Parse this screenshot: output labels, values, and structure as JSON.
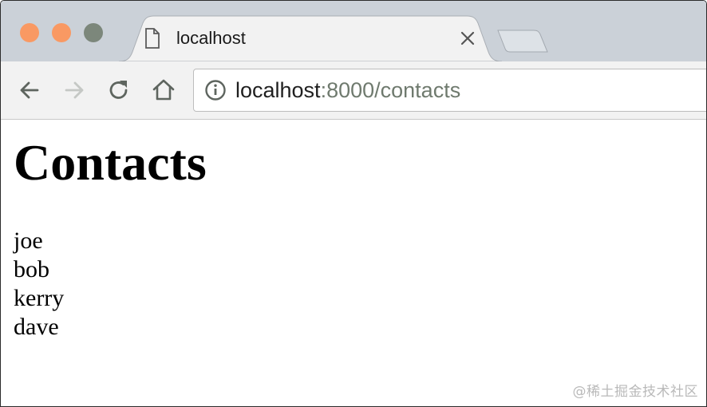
{
  "browser": {
    "tab": {
      "title": "localhost",
      "icon": "page-icon",
      "close_icon": "close-icon"
    },
    "toolbar": {
      "back_icon": "back-arrow-icon",
      "forward_icon": "forward-arrow-icon",
      "reload_icon": "reload-icon",
      "home_icon": "home-icon"
    },
    "address_bar": {
      "info_icon": "info-icon",
      "host": "localhost",
      "path": ":8000/contacts"
    },
    "colors": {
      "tabstrip_bg": "#cbd1d8",
      "toolbar_bg": "#f2f2f2",
      "close_light": "#f99963",
      "minimize_light": "#f99963",
      "zoom_light": "#7c877b",
      "url_secondary": "#6f7a6e"
    }
  },
  "page": {
    "title": "Contacts",
    "contacts": [
      "joe",
      "bob",
      "kerry",
      "dave"
    ]
  },
  "watermark": "@稀土掘金技术社区"
}
